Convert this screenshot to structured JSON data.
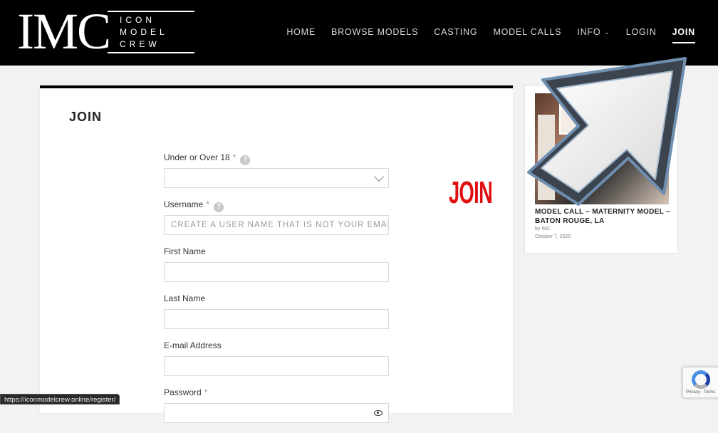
{
  "header": {
    "logo_mark": "IMC",
    "logo_lines": [
      "ICON",
      "MODEL",
      "CREW"
    ],
    "nav": [
      {
        "label": "HOME"
      },
      {
        "label": "BROWSE MODELS"
      },
      {
        "label": "CASTING"
      },
      {
        "label": "MODEL CALLS"
      },
      {
        "label": "INFO"
      },
      {
        "label": "LOGIN"
      },
      {
        "label": "JOIN",
        "active": true
      }
    ]
  },
  "main": {
    "title": "JOIN",
    "ad_text": "JOIN",
    "form": {
      "age": {
        "label": "Under or Over 18",
        "required": "*",
        "help": "?",
        "value": ""
      },
      "username": {
        "label": "Username",
        "required": "*",
        "help": "?",
        "placeholder": "CREATE A USER NAME THAT IS NOT YOUR EMAIL AD"
      },
      "first_name": {
        "label": "First Name",
        "value": ""
      },
      "last_name": {
        "label": "Last Name",
        "value": ""
      },
      "email": {
        "label": "E-mail Address",
        "value": ""
      },
      "password": {
        "label": "Password",
        "required": "*",
        "value": ""
      }
    }
  },
  "sidebar": {
    "post_title": "MODEL CALL – MATERNITY MODEL – BATON ROUGE, LA",
    "post_by": "by IMC",
    "post_date": "October 7, 2025"
  },
  "status_bar": {
    "url": "https://iconmodelcrew.online/register/"
  },
  "recaptcha": {
    "text": "Privacy - Terms"
  },
  "colors": {
    "header_bg": "#000000",
    "ad_red": "#e01010",
    "accent": "#000000"
  }
}
